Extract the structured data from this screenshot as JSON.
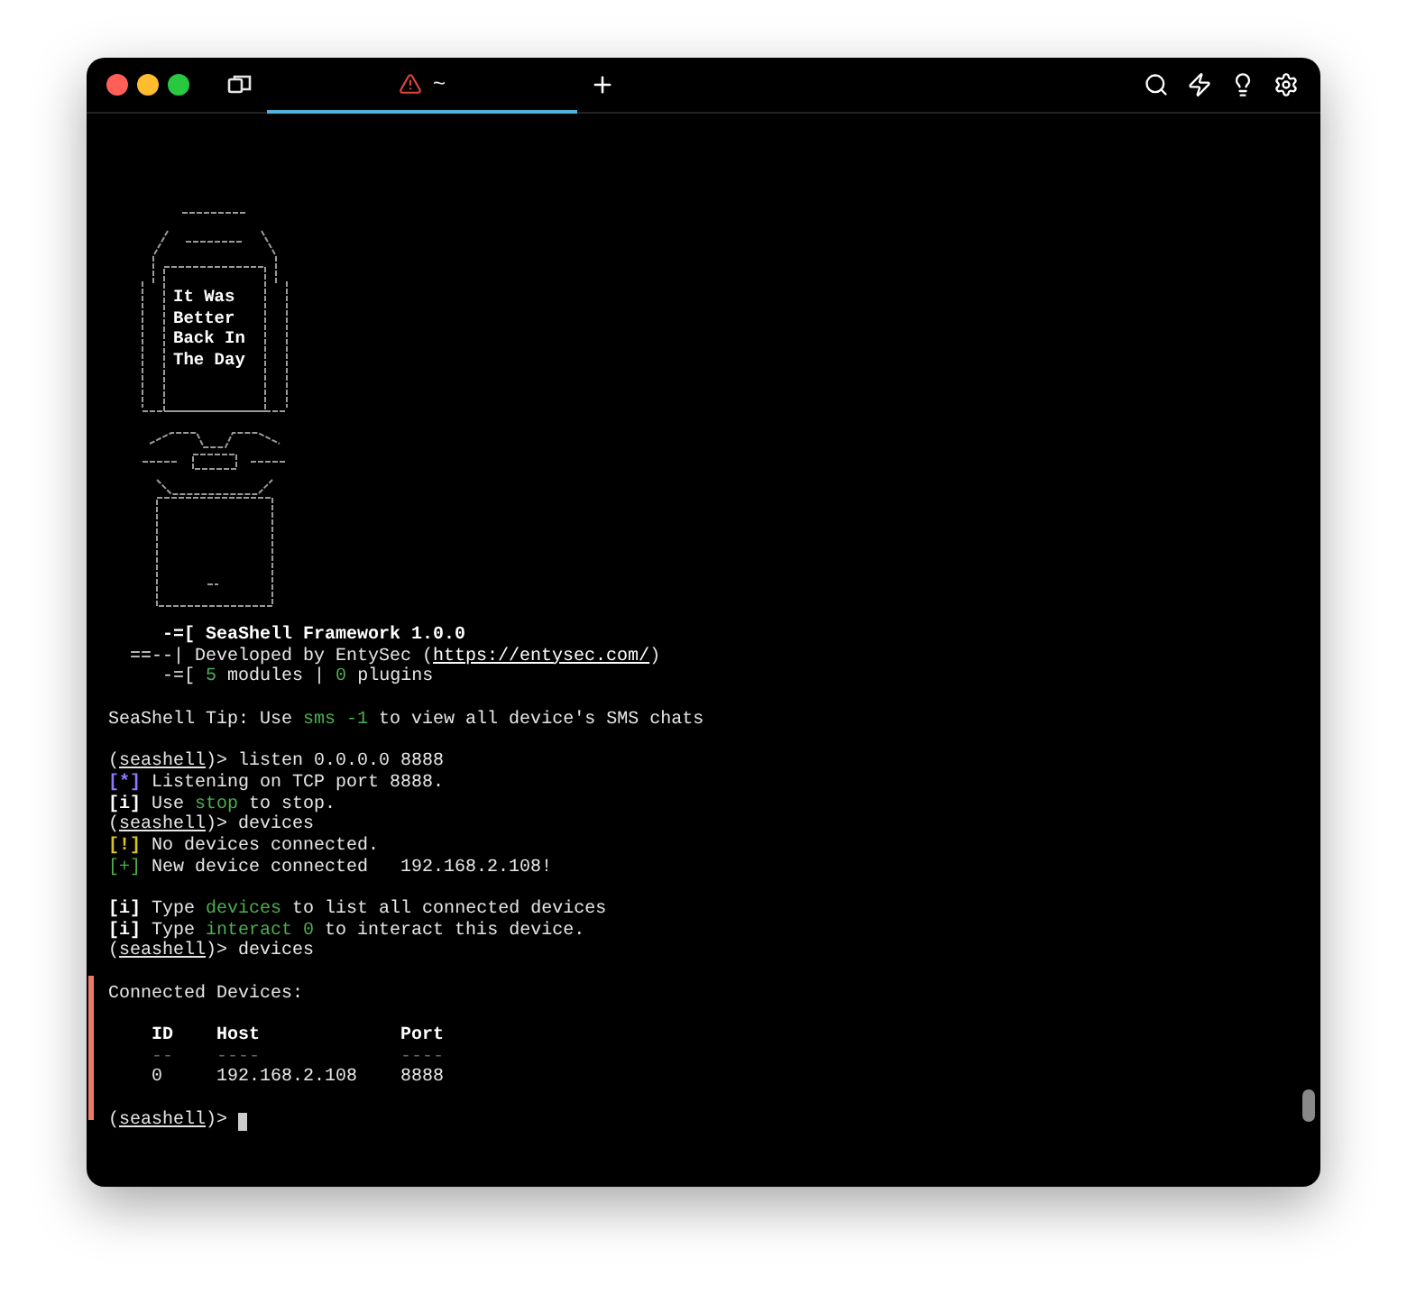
{
  "tab": {
    "title": "~",
    "selected": true
  },
  "splash_art": {
    "lines": [
      "It Was",
      "Better",
      "Back In",
      "The Day"
    ]
  },
  "lines": [
    {
      "kind": "text",
      "segments": [
        {
          "kind": "bold",
          "text": "     -=[ SeaShell Framework 1.0.0"
        }
      ]
    },
    {
      "kind": "text",
      "segments": [
        {
          "kind": "plain",
          "text": "  ==--| Developed by EntySec ("
        },
        {
          "kind": "link",
          "text": "https://entysec.com/"
        },
        {
          "kind": "plain",
          "text": ")"
        }
      ]
    },
    {
      "kind": "text",
      "segments": [
        {
          "kind": "plain",
          "text": "     -=[ "
        },
        {
          "kind": "green",
          "text": "5"
        },
        {
          "kind": "plain",
          "text": " modules | "
        },
        {
          "kind": "green",
          "text": "0"
        },
        {
          "kind": "plain",
          "text": " plugins"
        }
      ]
    },
    {
      "kind": "blank"
    },
    {
      "kind": "text",
      "segments": [
        {
          "kind": "plain",
          "text": "SeaShell Tip: Use "
        },
        {
          "kind": "green",
          "text": "sms -1"
        },
        {
          "kind": "plain",
          "text": " to view all device's SMS chats"
        }
      ]
    },
    {
      "kind": "blank"
    },
    {
      "kind": "text",
      "segments": [
        {
          "kind": "plain",
          "text": "("
        },
        {
          "kind": "prompt",
          "text": "seashell"
        },
        {
          "kind": "plain",
          "text": ")> listen 0.0.0.0 8888"
        }
      ]
    },
    {
      "kind": "text",
      "segments": [
        {
          "kind": "purple",
          "text": "[*]"
        },
        {
          "kind": "plain",
          "text": " Listening on TCP port 8888."
        }
      ]
    },
    {
      "kind": "text",
      "segments": [
        {
          "kind": "bold",
          "text": "[i]"
        },
        {
          "kind": "plain",
          "text": " Use "
        },
        {
          "kind": "green",
          "text": "stop"
        },
        {
          "kind": "plain",
          "text": " to stop."
        }
      ]
    },
    {
      "kind": "text",
      "segments": [
        {
          "kind": "plain",
          "text": "("
        },
        {
          "kind": "prompt",
          "text": "seashell"
        },
        {
          "kind": "plain",
          "text": ")> devices"
        }
      ]
    },
    {
      "kind": "text",
      "segments": [
        {
          "kind": "yellow",
          "text": "[!]"
        },
        {
          "kind": "plain",
          "text": " No devices connected."
        }
      ]
    },
    {
      "kind": "text",
      "segments": [
        {
          "kind": "green",
          "text": "[+]"
        },
        {
          "kind": "plain",
          "text": " New device connected   192.168.2.108!"
        }
      ]
    },
    {
      "kind": "blank"
    },
    {
      "kind": "text",
      "segments": [
        {
          "kind": "bold",
          "text": "[i]"
        },
        {
          "kind": "plain",
          "text": " Type "
        },
        {
          "kind": "green",
          "text": "devices"
        },
        {
          "kind": "plain",
          "text": " to list all connected devices"
        }
      ]
    },
    {
      "kind": "text",
      "segments": [
        {
          "kind": "bold",
          "text": "[i]"
        },
        {
          "kind": "plain",
          "text": " Type "
        },
        {
          "kind": "green",
          "text": "interact 0"
        },
        {
          "kind": "plain",
          "text": " to interact this device."
        }
      ]
    },
    {
      "kind": "text",
      "segments": [
        {
          "kind": "plain",
          "text": "("
        },
        {
          "kind": "prompt",
          "text": "seashell"
        },
        {
          "kind": "plain",
          "text": ")> devices"
        }
      ]
    },
    {
      "kind": "blank"
    },
    {
      "kind": "text",
      "segments": [
        {
          "kind": "plain",
          "text": "Connected Devices:"
        }
      ]
    },
    {
      "kind": "blank"
    },
    {
      "kind": "text",
      "segments": [
        {
          "kind": "bold",
          "text": "    ID    Host             Port"
        }
      ]
    },
    {
      "kind": "text",
      "segments": [
        {
          "kind": "dim",
          "text": "    --    ----             ----"
        }
      ]
    },
    {
      "kind": "text",
      "segments": [
        {
          "kind": "plain",
          "text": "    0     192.168.2.108    8888"
        }
      ]
    },
    {
      "kind": "blank"
    },
    {
      "kind": "input",
      "segments": [
        {
          "kind": "plain",
          "text": "("
        },
        {
          "kind": "prompt",
          "text": "seashell"
        },
        {
          "kind": "plain",
          "text": ")> "
        }
      ]
    }
  ]
}
